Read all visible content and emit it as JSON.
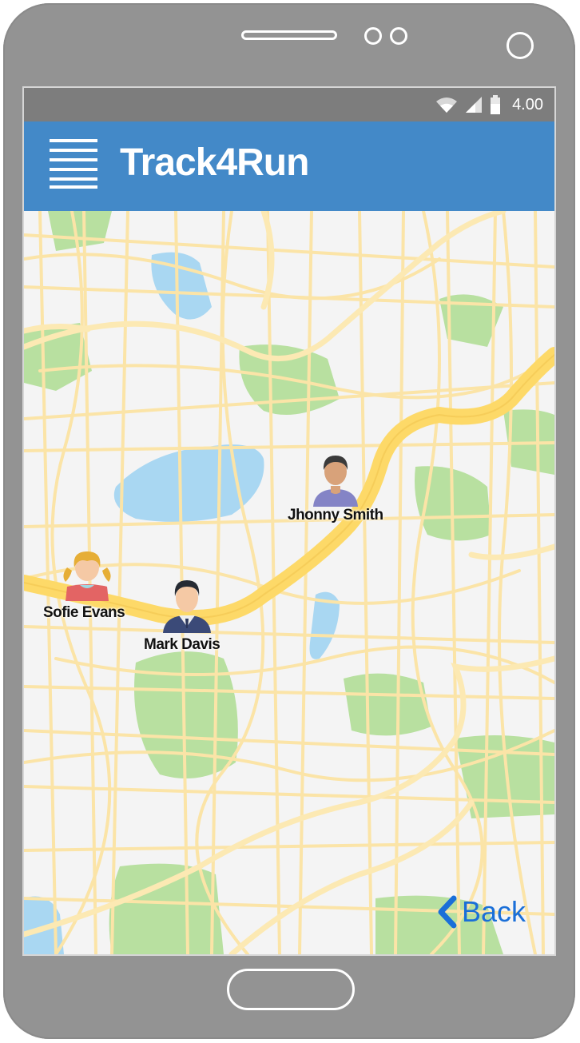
{
  "app": {
    "title": "Track4Run"
  },
  "status_bar": {
    "time": "4.00",
    "icons": [
      "wifi-icon",
      "signal-icon",
      "battery-icon"
    ]
  },
  "map": {
    "runners": [
      {
        "name": "Jhonny Smith",
        "avatar": "man-purple-shirt-avatar"
      },
      {
        "name": "Sofie Evans",
        "avatar": "girl-pigtails-avatar"
      },
      {
        "name": "Mark Davis",
        "avatar": "man-suit-avatar"
      }
    ]
  },
  "navigation": {
    "back_label": "Back"
  },
  "colors": {
    "app_bar": "#4389c8",
    "status_bar": "#7d7d7d",
    "phone_body": "#939393",
    "road_major": "#fdd968",
    "road_minor": "#fbe4a7",
    "park": "#b8e0a0",
    "water": "#a9d7f2",
    "back_link": "#1a6fd8"
  }
}
